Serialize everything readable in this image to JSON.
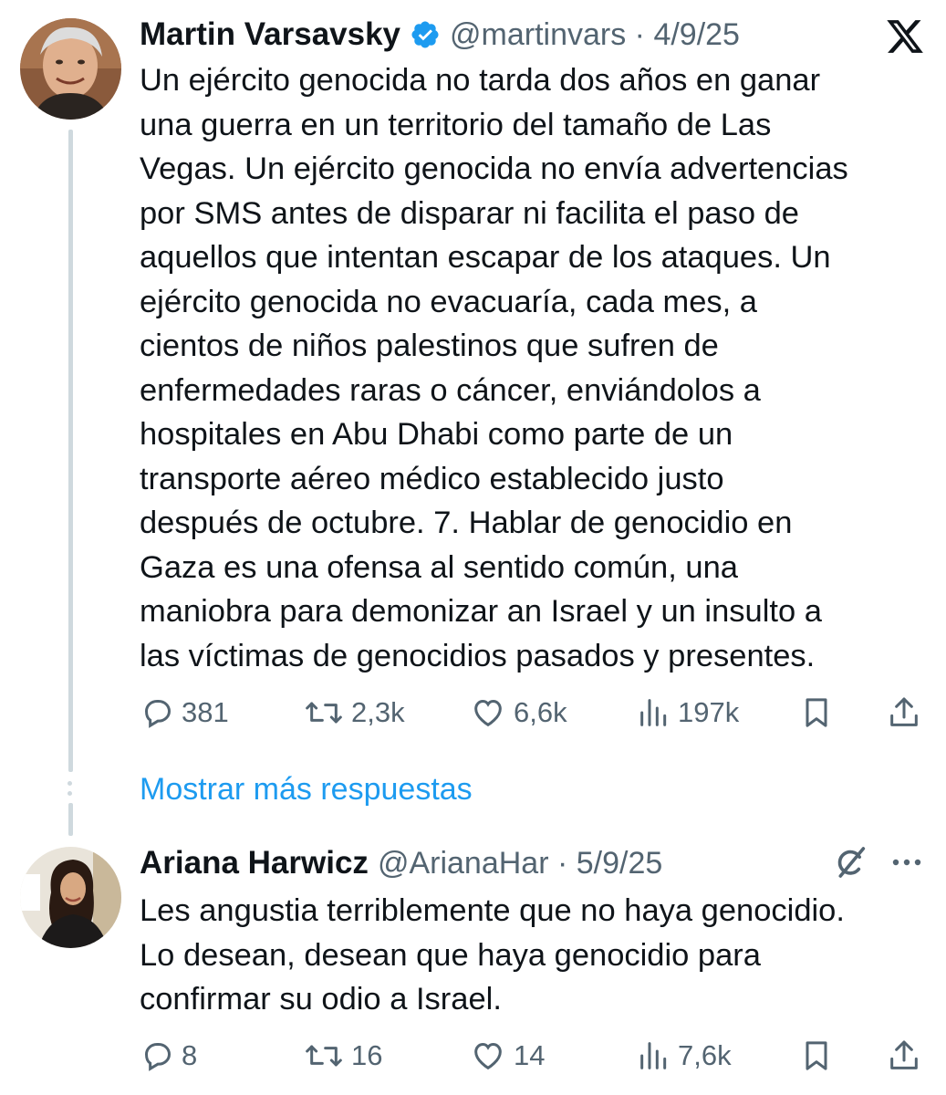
{
  "tweet1": {
    "author_name": "Martin Varsavsky",
    "handle_date": "@martinvars · 4/9/25",
    "body_lines": [
      "Un ejército genocida no tarda dos años en ganar",
      "una guerra en un territorio del tamaño de Las",
      "Vegas. Un ejército genocida no envía advertencias",
      "por SMS antes de disparar ni facilita el paso de",
      "aquellos que intentan escapar de los ataques. Un",
      "ejército genocida no evacuaría, cada mes, a",
      "cientos de niños palestinos que sufren de",
      "enfermedades raras o cáncer, enviándolos a",
      "hospitales en Abu Dhabi como parte de un",
      "transporte aéreo médico establecido justo",
      "después de octubre. 7. Hablar de genocidio en",
      "Gaza es una ofensa al sentido común, una",
      "maniobra para demonizar an Israel y un insulto a",
      "las víctimas de genocidios pasados y presentes."
    ],
    "replies": "381",
    "reposts": "2,3k",
    "likes": "6,6k",
    "views": "197k"
  },
  "show_more_replies": "Mostrar más respuestas",
  "tweet2": {
    "author_name": "Ariana Harwicz",
    "handle_date": "@ArianaHar · 5/9/25",
    "body_lines": [
      "Les angustia terriblemente que no haya genocidio.",
      "Lo desean, desean que haya genocidio para",
      "confirmar su odio a Israel."
    ],
    "replies": "8",
    "reposts": "16",
    "likes": "14",
    "views": "7,6k"
  },
  "colors": {
    "text": "#0f1419",
    "secondary": "#536471",
    "link": "#1d9bf0",
    "verified": "#1d9bf0",
    "thread_line": "#cfd9de"
  },
  "icons": [
    "x-logo-icon",
    "verified-badge-icon",
    "reply-icon",
    "repost-icon",
    "like-icon",
    "views-icon",
    "bookmark-icon",
    "share-icon",
    "grok-icon",
    "more-icon"
  ]
}
